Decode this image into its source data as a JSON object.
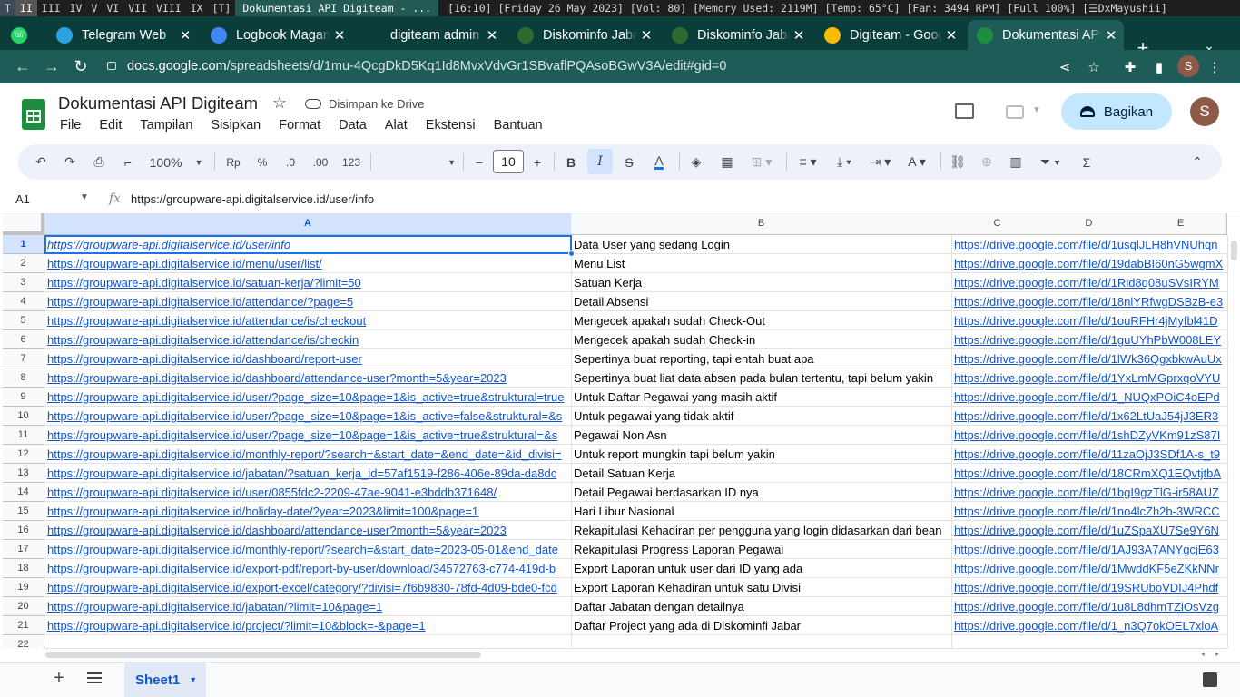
{
  "wm": {
    "logo": "T",
    "workspaces": [
      "II",
      "III",
      "IV",
      "V",
      "VI",
      "VII",
      "VIII",
      "IX",
      "[T]"
    ],
    "window_title": "Dokumentasi API Digiteam - ...",
    "status": "[16:10] [Friday 26 May 2023] [Vol: 80] [Memory Used: 2119M] [Temp: 65°C] [Fan: 3494 RPM] [Full 100%] [☰DxMayushii]"
  },
  "tabs": [
    {
      "title": "Telegram Web",
      "icon_color": "#2aa3e0",
      "icon": "telegram-icon"
    },
    {
      "title": "Logbook Magang",
      "icon_color": "#4285f4",
      "icon": "docs-icon"
    },
    {
      "title": "digiteam admin",
      "icon_color": "#0b3d3a",
      "icon": "digiteam-icon"
    },
    {
      "title": "Diskominfo Jabar",
      "icon_color": "#2f6b2f",
      "icon": "diskominfo-icon"
    },
    {
      "title": "Diskominfo Jabar",
      "icon_color": "#2f6b2f",
      "icon": "diskominfo-icon"
    },
    {
      "title": "Digiteam - Google Drive",
      "icon_color": "#fbbc04",
      "icon": "drive-icon"
    },
    {
      "title": "Dokumentasi API Digiteam",
      "icon_color": "#1e8e3e",
      "icon": "sheets-icon",
      "active": true
    }
  ],
  "tab_close": "✕",
  "address": {
    "host": "docs.google.com",
    "path": "/spreadsheets/d/1mu-4QcgDkD5Kq1Id8MvxVdvGr1SBvaflPQAsoBGwV3A/edit#gid=0",
    "avatar": "S"
  },
  "doc": {
    "title": "Dokumentasi API Digiteam",
    "save_status": "Disimpan ke Drive",
    "menu": [
      "File",
      "Edit",
      "Tampilan",
      "Sisipkan",
      "Format",
      "Data",
      "Alat",
      "Ekstensi",
      "Bantuan"
    ],
    "share_label": "Bagikan",
    "avatar": "S"
  },
  "toolbar": {
    "zoom": "100%",
    "currency": "Rp",
    "percent": "%",
    "dec_decrease": ".0",
    "dec_increase": ".00",
    "format_num": "123",
    "font_size": "10"
  },
  "formula": {
    "cell_ref": "A1",
    "fx": "fx",
    "value": "https://groupware-api.digitalservice.id/user/info"
  },
  "columns": [
    "A",
    "B",
    "C",
    "D",
    "E"
  ],
  "rows": [
    {
      "n": "1",
      "a": "https://groupware-api.digitalservice.id/user/info",
      "b": "Data User yang sedang Login",
      "c": "https://drive.google.com/file/d/1usqlJLH8hVNUhqn"
    },
    {
      "n": "2",
      "a": "https://groupware-api.digitalservice.id/menu/user/list/",
      "b": "Menu List",
      "c": "https://drive.google.com/file/d/19dabBI60nG5wgmX"
    },
    {
      "n": "3",
      "a": "https://groupware-api.digitalservice.id/satuan-kerja/?limit=50",
      "b": "Satuan Kerja",
      "c": "https://drive.google.com/file/d/1Rid8q08uSVsIRYM"
    },
    {
      "n": "4",
      "a": "https://groupware-api.digitalservice.id/attendance/?page=5",
      "b": "Detail Absensi",
      "c": "https://drive.google.com/file/d/18nlYRfwgDSBzB-e3"
    },
    {
      "n": "5",
      "a": "https://groupware-api.digitalservice.id/attendance/is/checkout",
      "b": "Mengecek apakah sudah Check-Out",
      "c": "https://drive.google.com/file/d/1ouRFHr4jMyfbl41D"
    },
    {
      "n": "6",
      "a": "https://groupware-api.digitalservice.id/attendance/is/checkin",
      "b": "Mengecek apakah sudah Check-in",
      "c": "https://drive.google.com/file/d/1guUYhPbW008LEY"
    },
    {
      "n": "7",
      "a": "https://groupware-api.digitalservice.id/dashboard/report-user",
      "b": "Sepertinya buat reporting, tapi entah buat apa",
      "c": "https://drive.google.com/file/d/1lWk36QgxbkwAuUx"
    },
    {
      "n": "8",
      "a": "https://groupware-api.digitalservice.id/dashboard/attendance-user?month=5&year=2023",
      "b": "Sepertinya buat liat data absen pada bulan tertentu, tapi belum yakin",
      "c": "https://drive.google.com/file/d/1YxLmMGprxqoVYU"
    },
    {
      "n": "9",
      "a": "https://groupware-api.digitalservice.id/user/?page_size=10&page=1&is_active=true&struktural=true",
      "b": "Untuk Daftar Pegawai yang masih aktif",
      "c": "https://drive.google.com/file/d/1_NUQxPOiC4oEPd"
    },
    {
      "n": "10",
      "a": "https://groupware-api.digitalservice.id/user/?page_size=10&page=1&is_active=false&struktural=&s",
      "b": "Untuk pegawai yang tidak aktif",
      "c": "https://drive.google.com/file/d/1x62LtUaJ54jJ3ER3"
    },
    {
      "n": "11",
      "a": "https://groupware-api.digitalservice.id/user/?page_size=10&page=1&is_active=true&struktural=&s",
      "b": "Pegawai Non Asn",
      "c": "https://drive.google.com/file/d/1shDZyVKm91zS87I"
    },
    {
      "n": "12",
      "a": "https://groupware-api.digitalservice.id/monthly-report/?search=&start_date=&end_date=&id_divisi=",
      "b": "Untuk report mungkin tapi belum yakin",
      "c": "https://drive.google.com/file/d/11zaOjJ3SDf1A-s_t9"
    },
    {
      "n": "13",
      "a": "https://groupware-api.digitalservice.id/jabatan/?satuan_kerja_id=57af1519-f286-406e-89da-da8dc",
      "b": "Detail Satuan Kerja",
      "c": "https://drive.google.com/file/d/18CRmXQ1EQvtjtbA"
    },
    {
      "n": "14",
      "a": "https://groupware-api.digitalservice.id/user/0855fdc2-2209-47ae-9041-e3bddb371648/",
      "b": "Detail Pegawai berdasarkan ID nya",
      "c": "https://drive.google.com/file/d/1bgI9gzTlG-ir58AUZ"
    },
    {
      "n": "15",
      "a": "https://groupware-api.digitalservice.id/holiday-date/?year=2023&limit=100&page=1",
      "b": "Hari Libur Nasional",
      "c": "https://drive.google.com/file/d/1no4lcZh2b-3WRCC"
    },
    {
      "n": "16",
      "a": "https://groupware-api.digitalservice.id/dashboard/attendance-user?month=5&year=2023",
      "b": "Rekapitulasi Kehadiran per pengguna yang login didasarkan dari bean",
      "c": "https://drive.google.com/file/d/1uZSpaXU7Se9Y6N"
    },
    {
      "n": "17",
      "a": "https://groupware-api.digitalservice.id/monthly-report/?search=&start_date=2023-05-01&end_date",
      "b": "Rekapitulasi Progress Laporan Pegawai",
      "c": "https://drive.google.com/file/d/1AJ93A7ANYgcjE63"
    },
    {
      "n": "18",
      "a": "https://groupware-api.digitalservice.id/export-pdf/report-by-user/download/34572763-c774-419d-b",
      "b": "Export Laporan untuk user dari ID yang ada",
      "c": "https://drive.google.com/file/d/1MwddKF5eZKkNNr"
    },
    {
      "n": "19",
      "a": "https://groupware-api.digitalservice.id/export-excel/category/?divisi=7f6b9830-78fd-4d09-bde0-fcd",
      "b": "Export Laporan Kehadiran untuk satu Divisi",
      "c": "https://drive.google.com/file/d/19SRUboVDIJ4Phdf"
    },
    {
      "n": "20",
      "a": "https://groupware-api.digitalservice.id/jabatan/?limit=10&page=1",
      "b": "Daftar Jabatan dengan detailnya",
      "c": "https://drive.google.com/file/d/1u8L8dhmTZiOsVzg"
    },
    {
      "n": "21",
      "a": "https://groupware-api.digitalservice.id/project/?limit=10&block=-&page=1",
      "b": "Daftar Project yang ada di Diskominfi Jabar",
      "c": "https://drive.google.com/file/d/1_n3Q7okOEL7xloA"
    },
    {
      "n": "22",
      "a": "",
      "b": "",
      "c": ""
    }
  ],
  "sheet_tab": "Sheet1",
  "colors": {
    "accent": "#1a73e8",
    "chrome_dark": "#0b3d3a",
    "chrome": "#1e5c57",
    "link": "#1155cc",
    "share_bg": "#c2e7ff"
  }
}
